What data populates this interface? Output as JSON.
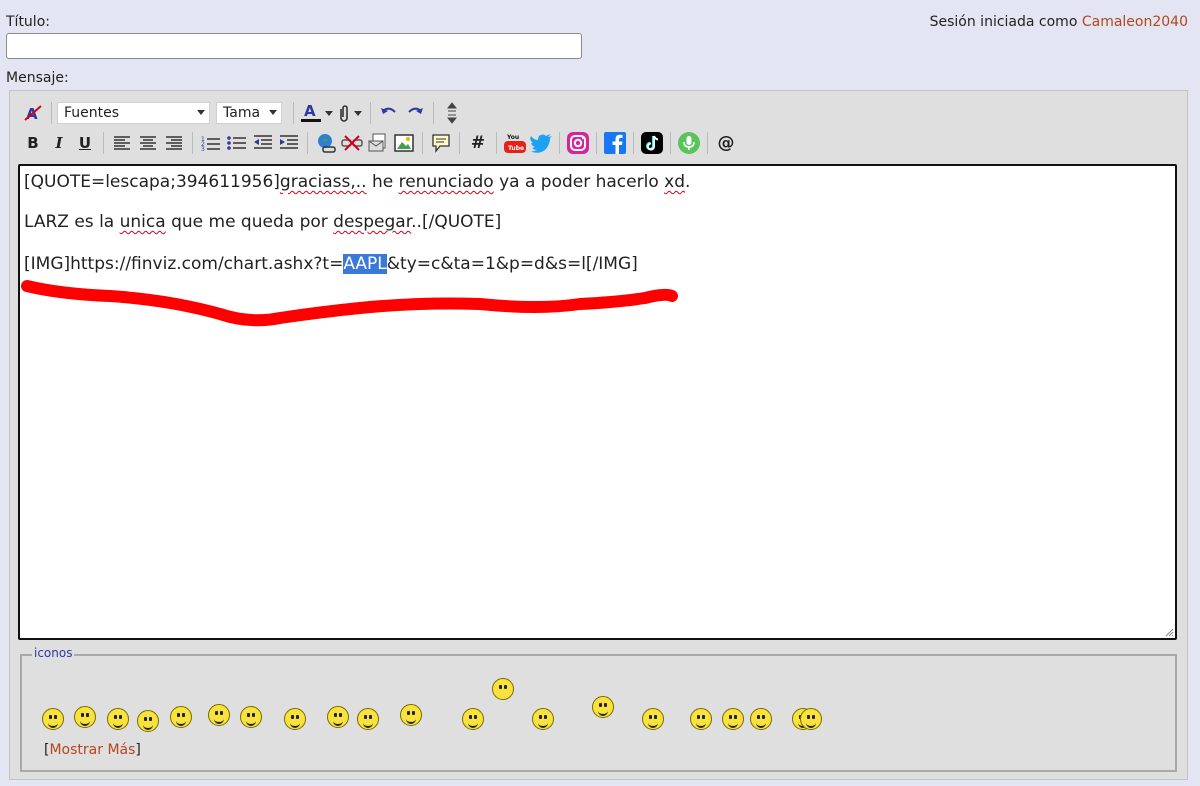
{
  "labels": {
    "title": "Título:",
    "message": "Mensaje:"
  },
  "session": {
    "prefix": "Sesión iniciada como ",
    "username": "Camaleon2040"
  },
  "title_input": {
    "value": ""
  },
  "toolbar": {
    "font_select": "Fuentes",
    "size_select": "Tama",
    "row1_icons": [
      "remove-format-icon",
      "font-color-icon",
      "attach-icon",
      "undo-icon",
      "redo-icon",
      "resize-toggle-icon"
    ],
    "row2_icons": [
      "bold-icon",
      "italic-icon",
      "underline-icon",
      "align-left-icon",
      "align-center-icon",
      "align-right-icon",
      "ordered-list-icon",
      "unordered-list-icon",
      "outdent-icon",
      "indent-icon",
      "insert-link-icon",
      "unlink-icon",
      "insert-email-icon",
      "insert-image-icon",
      "quote-icon",
      "hashtag-icon",
      "youtube-icon",
      "twitter-icon",
      "instagram-icon",
      "facebook-icon",
      "tiktok-icon",
      "podcast-icon",
      "mention-icon"
    ],
    "labels": {
      "bold": "B",
      "italic": "I",
      "underline": "U",
      "hashtag": "#",
      "mention": "@"
    },
    "colors": {
      "font_color_bar": "#111111",
      "youtube": "#e62117",
      "twitter": "#1da1f2",
      "instagram": "#d6249f",
      "facebook": "#1877f2",
      "tiktok": "#000000",
      "podcast": "#5ac35a"
    }
  },
  "editor": {
    "line1": {
      "a": "[QUOTE=lescapa;394611956]",
      "b": "graciass,..",
      "c": " he ",
      "d": "renunciado",
      "e": " ya a poder hacerlo ",
      "f": "xd",
      "g": "."
    },
    "line2": {
      "a": "LARZ es la ",
      "b": "unica",
      "c": " que me queda por ",
      "d": "despegar",
      "e": "..[/QUOTE]"
    },
    "line3": {
      "a": "[IMG]https://finviz.com/chart.ashx?t=",
      "b": "AAPL",
      "c": "&ty=c&ta=1&p=d&s=l[/IMG]"
    },
    "annotation_color": "#ff0000",
    "selection_color": "#3a79d8"
  },
  "icons_panel": {
    "legend": "iconos",
    "show_more": {
      "open": "[",
      "link": "Mostrar Más",
      "close": "]"
    },
    "smiley_count": 20
  }
}
